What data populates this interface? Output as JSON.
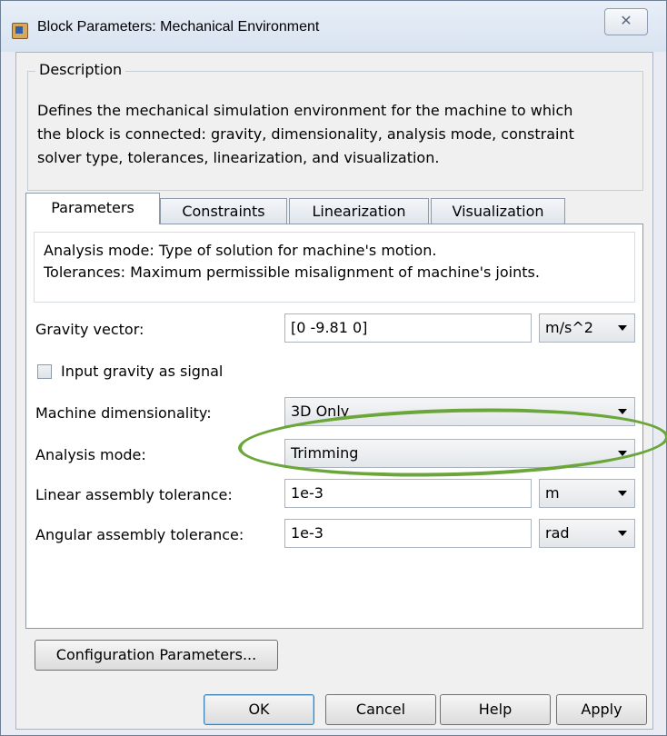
{
  "window": {
    "title": "Block Parameters: Mechanical Environment",
    "close_glyph": "✕",
    "app_icon": "simulink-block-icon"
  },
  "description": {
    "legend": "Description",
    "lines": [
      "Defines the mechanical simulation environment for the machine to which",
      "the block is connected: gravity, dimensionality, analysis mode, constraint",
      "solver type, tolerances, linearization, and visualization."
    ]
  },
  "tabs": [
    {
      "label": "Parameters",
      "active": true
    },
    {
      "label": "Constraints",
      "active": false
    },
    {
      "label": "Linearization",
      "active": false
    },
    {
      "label": "Visualization",
      "active": false
    }
  ],
  "hint": {
    "lines": [
      "Analysis mode: Type of solution for machine's motion.",
      "Tolerances: Maximum permissible misalignment of machine's joints."
    ]
  },
  "params": {
    "gravity_label": "Gravity vector:",
    "gravity_value": "[0 -9.81 0]",
    "gravity_unit": "m/s^2",
    "input_gravity_label": "Input gravity as signal",
    "input_gravity_checked": false,
    "dimensionality_label": "Machine dimensionality:",
    "dimensionality_value": "3D Only",
    "analysis_label": "Analysis mode:",
    "analysis_value": "Trimming",
    "linear_tol_label": "Linear assembly tolerance:",
    "linear_tol_value": "1e-3",
    "linear_tol_unit": "m",
    "angular_tol_label": "Angular assembly tolerance:",
    "angular_tol_value": "1e-3",
    "angular_tol_unit": "rad"
  },
  "buttons": {
    "config": "Configuration Parameters...",
    "ok": "OK",
    "cancel": "Cancel",
    "help": "Help",
    "apply": "Apply"
  },
  "colors": {
    "highlight_ellipse": "#6ba63a"
  }
}
